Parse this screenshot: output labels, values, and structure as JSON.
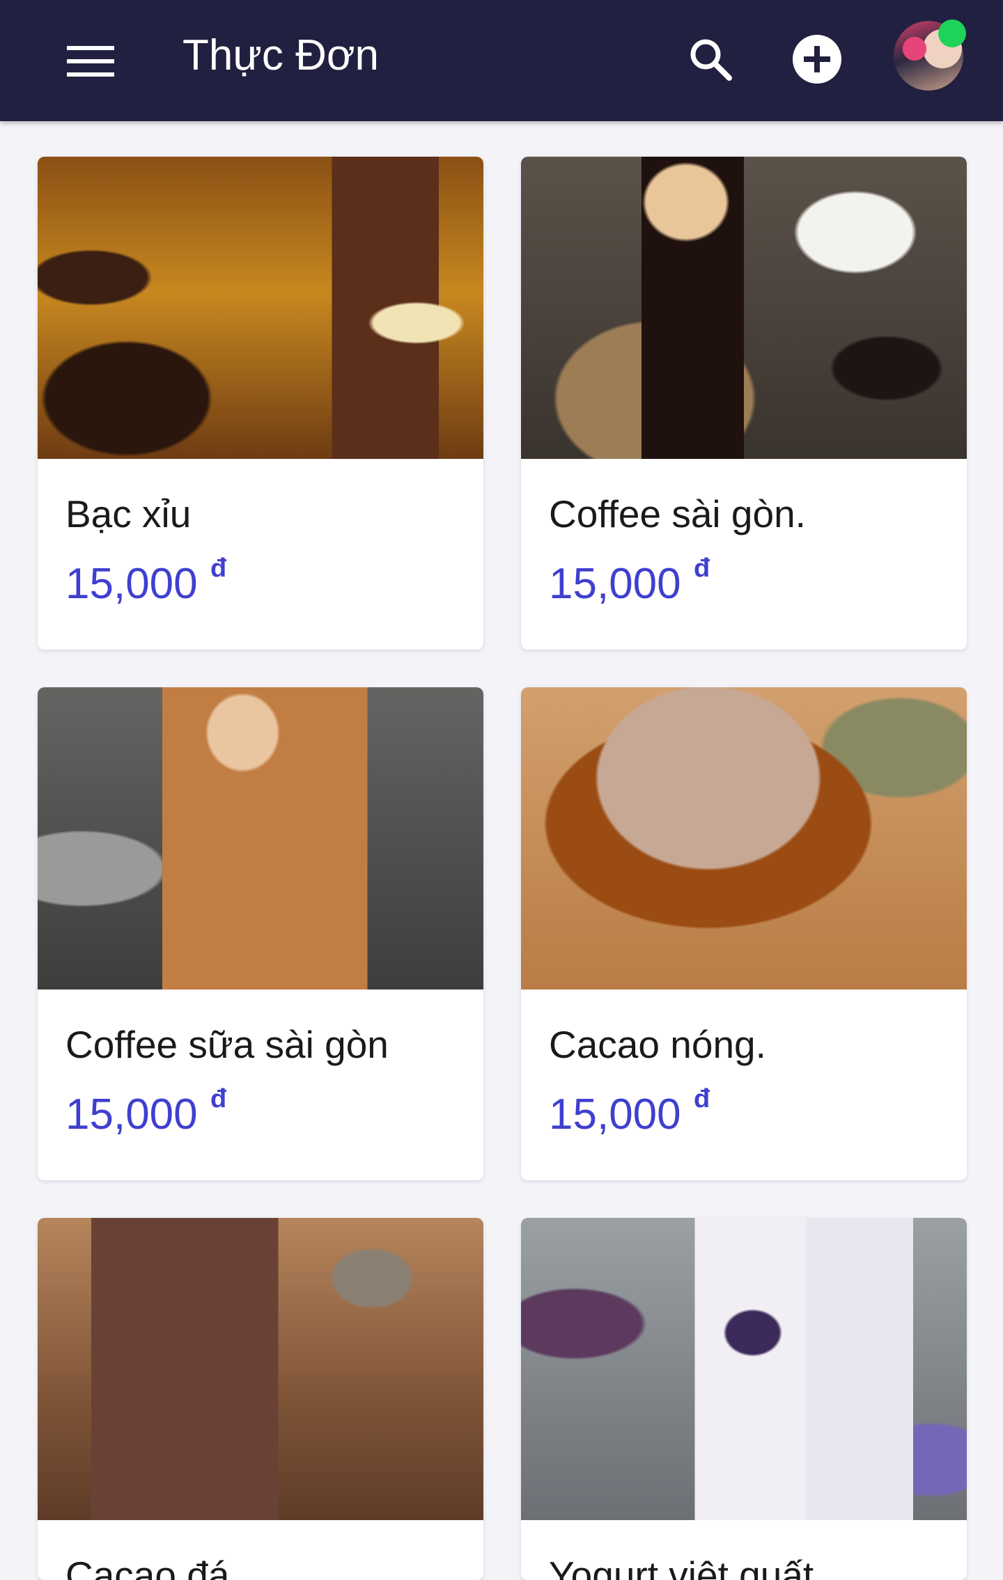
{
  "appbar": {
    "title": "Thực Đơn",
    "menu_icon": "hamburger-menu-icon",
    "search_icon": "search-icon",
    "add_icon": "plus-circle-icon",
    "online_color": "#1fd35a",
    "background": "#222040"
  },
  "menu": {
    "currency": "đ",
    "price_color": "#3f3fd0",
    "items": [
      {
        "name": "Bạc xỉu",
        "price": "15,000"
      },
      {
        "name": "Coffee sài gòn.",
        "price": "15,000"
      },
      {
        "name": "Coffee sữa sài gòn",
        "price": "15,000"
      },
      {
        "name": "Cacao nóng.",
        "price": "15,000"
      },
      {
        "name": "Cacao đá",
        "price": ""
      },
      {
        "name": "Yogurt việt quất",
        "price": ""
      }
    ]
  }
}
